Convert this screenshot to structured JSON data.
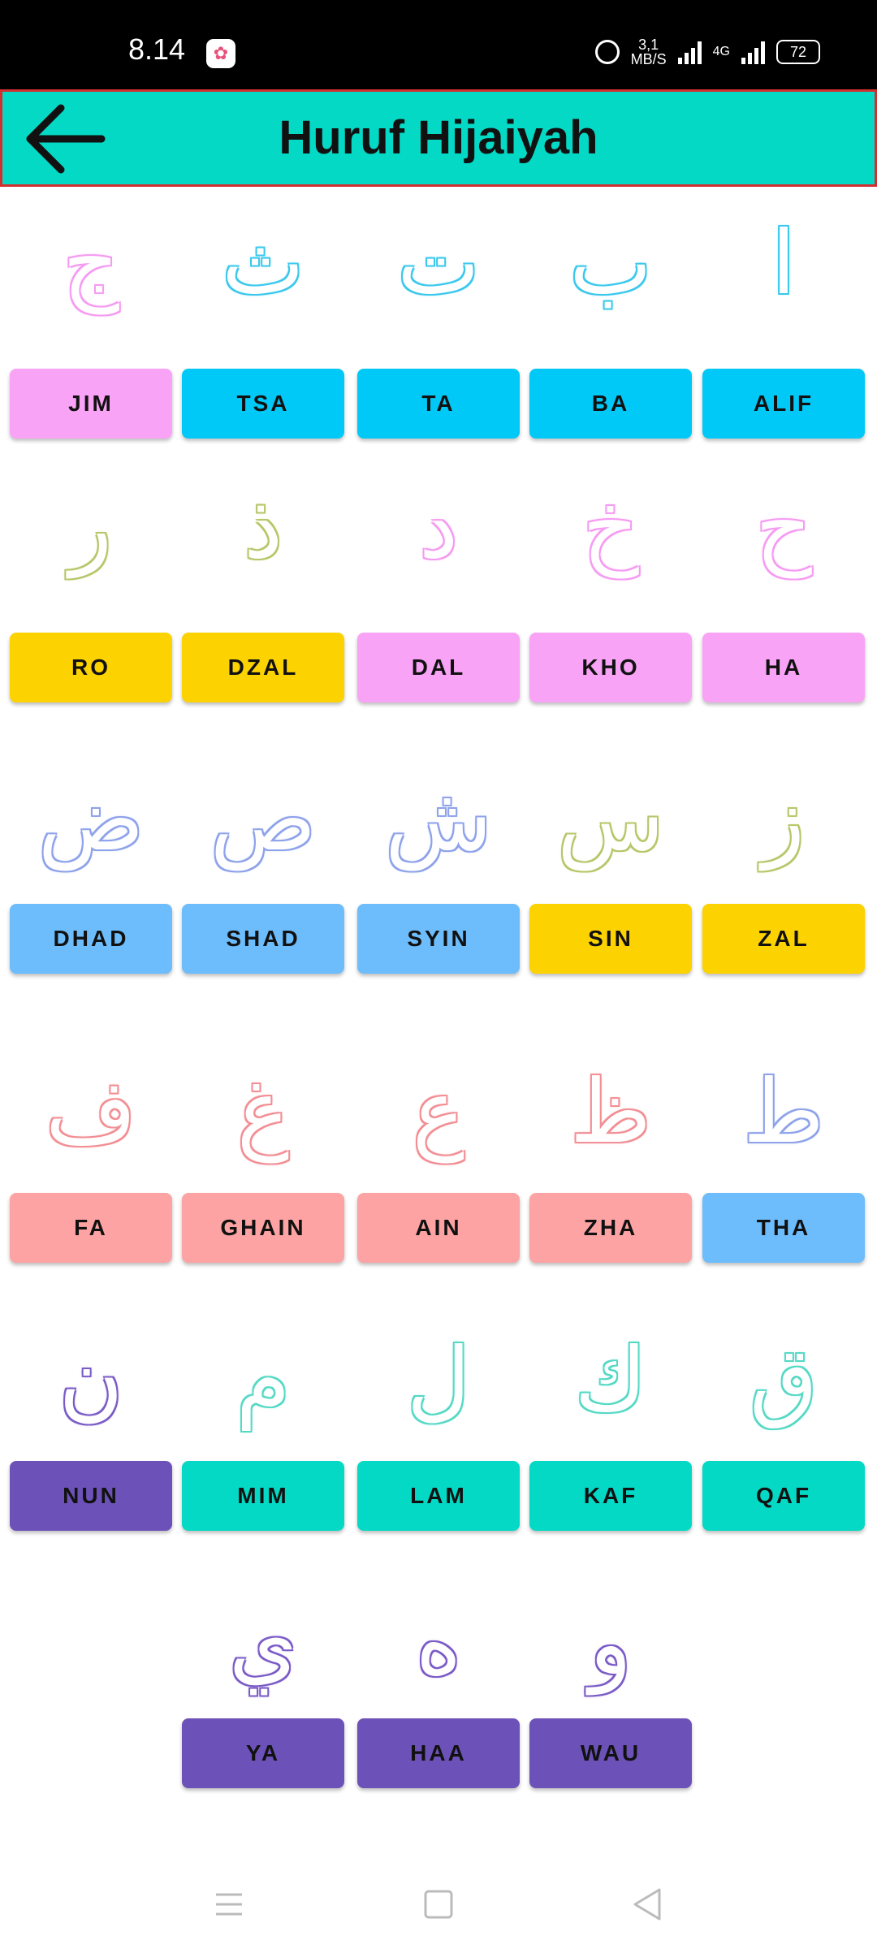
{
  "status_bar": {
    "time": "8.14",
    "speed_value": "3,1",
    "speed_unit": "MB/S",
    "network": "4G",
    "battery": "72"
  },
  "app_bar": {
    "title": "Huruf Hijaiyah"
  },
  "letters": [
    {
      "name": "JIM",
      "glyph": "ج",
      "glyph_color": "#f59cf2",
      "button_color": "#f9a3f6"
    },
    {
      "name": "TSA",
      "glyph": "ث",
      "glyph_color": "#3cc8ec",
      "button_color": "#00c9f7"
    },
    {
      "name": "TA",
      "glyph": "ت",
      "glyph_color": "#3cc8ec",
      "button_color": "#00c9f7"
    },
    {
      "name": "BA",
      "glyph": "ب",
      "glyph_color": "#3cc8ec",
      "button_color": "#00c9f7"
    },
    {
      "name": "ALIF",
      "glyph": "ا",
      "glyph_color": "#3cc8ec",
      "button_color": "#00c9f7"
    },
    {
      "name": "RO",
      "glyph": "ر",
      "glyph_color": "#b7c76a",
      "button_color": "#fdd201"
    },
    {
      "name": "DZAL",
      "glyph": "ذ",
      "glyph_color": "#b7c76a",
      "button_color": "#fdd201"
    },
    {
      "name": "DAL",
      "glyph": "د",
      "glyph_color": "#f59cf2",
      "button_color": "#f9a3f6"
    },
    {
      "name": "KHO",
      "glyph": "خ",
      "glyph_color": "#f59cf2",
      "button_color": "#f9a3f6"
    },
    {
      "name": "HA",
      "glyph": "ح",
      "glyph_color": "#f59cf2",
      "button_color": "#f9a3f6"
    },
    {
      "name": "DHAD",
      "glyph": "ض",
      "glyph_color": "#8fa3ea",
      "button_color": "#6dbdfd"
    },
    {
      "name": "SHAD",
      "glyph": "ص",
      "glyph_color": "#8fa3ea",
      "button_color": "#6dbdfd"
    },
    {
      "name": "SYIN",
      "glyph": "ش",
      "glyph_color": "#8fa3ea",
      "button_color": "#6dbdfd"
    },
    {
      "name": "SIN",
      "glyph": "س",
      "glyph_color": "#b7c76a",
      "button_color": "#fdd201"
    },
    {
      "name": "ZAL",
      "glyph": "ز",
      "glyph_color": "#b7c76a",
      "button_color": "#fdd201"
    },
    {
      "name": "FA",
      "glyph": "ف",
      "glyph_color": "#f28f95",
      "button_color": "#fda3a3"
    },
    {
      "name": "GHAIN",
      "glyph": "غ",
      "glyph_color": "#f28f95",
      "button_color": "#fda3a3"
    },
    {
      "name": "AIN",
      "glyph": "ع",
      "glyph_color": "#f28f95",
      "button_color": "#fda3a3"
    },
    {
      "name": "ZHA",
      "glyph": "ظ",
      "glyph_color": "#f28f95",
      "button_color": "#fda3a3"
    },
    {
      "name": "THA",
      "glyph": "ط",
      "glyph_color": "#8fa3ea",
      "button_color": "#6dbdfd"
    },
    {
      "name": "NUN",
      "glyph": "ن",
      "glyph_color": "#7b5cc7",
      "button_color": "#6c52b8"
    },
    {
      "name": "MIM",
      "glyph": "م",
      "glyph_color": "#56d9c5",
      "button_color": "#03d9c5"
    },
    {
      "name": "LAM",
      "glyph": "ل",
      "glyph_color": "#56d9c5",
      "button_color": "#03d9c5"
    },
    {
      "name": "KAF",
      "glyph": "ك",
      "glyph_color": "#56d9c5",
      "button_color": "#03d9c5"
    },
    {
      "name": "QAF",
      "glyph": "ق",
      "glyph_color": "#56d9c5",
      "button_color": "#03d9c5"
    },
    {
      "name": "YA",
      "glyph": "ي",
      "glyph_color": "#7b5cc7",
      "button_color": "#6c52b8"
    },
    {
      "name": "HAA",
      "glyph": "ه",
      "glyph_color": "#7b5cc7",
      "button_color": "#6c52b8"
    },
    {
      "name": "WAU",
      "glyph": "و",
      "glyph_color": "#7b5cc7",
      "button_color": "#6c52b8"
    }
  ],
  "nav_bar": {
    "items": [
      {
        "icon": "menu-icon"
      },
      {
        "icon": "home-square-icon"
      },
      {
        "icon": "back-triangle-icon"
      }
    ]
  }
}
